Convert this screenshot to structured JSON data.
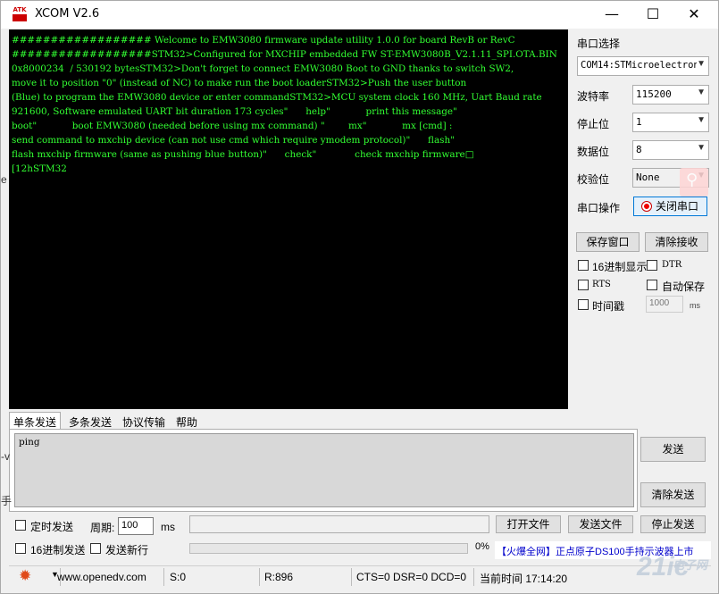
{
  "window": {
    "logo_text": "ATK",
    "title": "XCOM V2.6",
    "minimize": "—",
    "maximize": "☐",
    "close": "✕"
  },
  "terminal": {
    "text": "################## Welcome to EMW3080 firmware update utility 1.0.0 for board RevB or RevC\n##################STM32>Configured for MXCHIP embedded FW ST-EMW3080B_V2.1.11_SPI.OTA.BIN\n0x8000234  / 530192 bytesSTM32>Don't forget to connect EMW3080 Boot to GND thanks to switch SW2,\nmove it to position \"0\" (instead of NC) to make run the boot loaderSTM32>Push the user button\n(Blue) to program the EMW3080 device or enter commandSTM32>MCU system clock 160 MHz, Uart Baud rate\n921600, Software emulated UART bit duration 173 cycles\"      help\"            print this message\"\nboot\"            boot EMW3080 (needed before using mx command) \"        mx\"            mx [cmd] :\nsend command to mxchip device (can not use cmd which require ymodem protocol)\"      flash\"\nflash mxchip firmware (same as pushing blue button)\"      check\"             check mxchip firmware□\n[12hSTM32"
  },
  "settings": {
    "port_label": "串口选择",
    "port_value": "COM14:STMicroelectron",
    "baud_label": "波特率",
    "baud_value": "115200",
    "stopbits_label": "停止位",
    "stopbits_value": "1",
    "databits_label": "数据位",
    "databits_value": "8",
    "parity_label": "校验位",
    "parity_value": "None",
    "operation_label": "串口操作",
    "close_port_button": "关闭串口",
    "save_window_button": "保存窗口",
    "clear_receive_button": "清除接收",
    "hex_display_label": "16进制显示",
    "dtr_label": "DTR",
    "rts_label": "RTS",
    "autosave_label": "自动保存",
    "timestamp_label": "时间戳",
    "timestamp_ms_value": "1000",
    "ms_unit": "ms"
  },
  "tabs": [
    "单条发送",
    "多条发送",
    "协议传输",
    "帮助"
  ],
  "send": {
    "text": "ping",
    "send_button": "发送",
    "clear_send_button": "清除发送",
    "timed_send_label": "定时发送",
    "period_label": "周期:",
    "period_value": "100",
    "period_unit": "ms",
    "hex_send_label": "16进制发送",
    "send_newline_label": "发送新行",
    "open_file_button": "打开文件",
    "send_file_button": "发送文件",
    "stop_send_button": "停止发送",
    "progress_text": "0%",
    "progress_fraction": 0,
    "ad_text": "【火爆全网】正点原子DS100手持示波器上市"
  },
  "statusbar": {
    "website": "www.openedv.com",
    "sent": "S:0",
    "received": "R:896",
    "signals": "CTS=0 DSR=0 DCD=0",
    "time": "当前时间 17:14:20"
  },
  "watermark": {
    "main": "21ic",
    "sub": "电子网"
  },
  "background_fragments": [
    "e",
    "-v",
    "手"
  ]
}
